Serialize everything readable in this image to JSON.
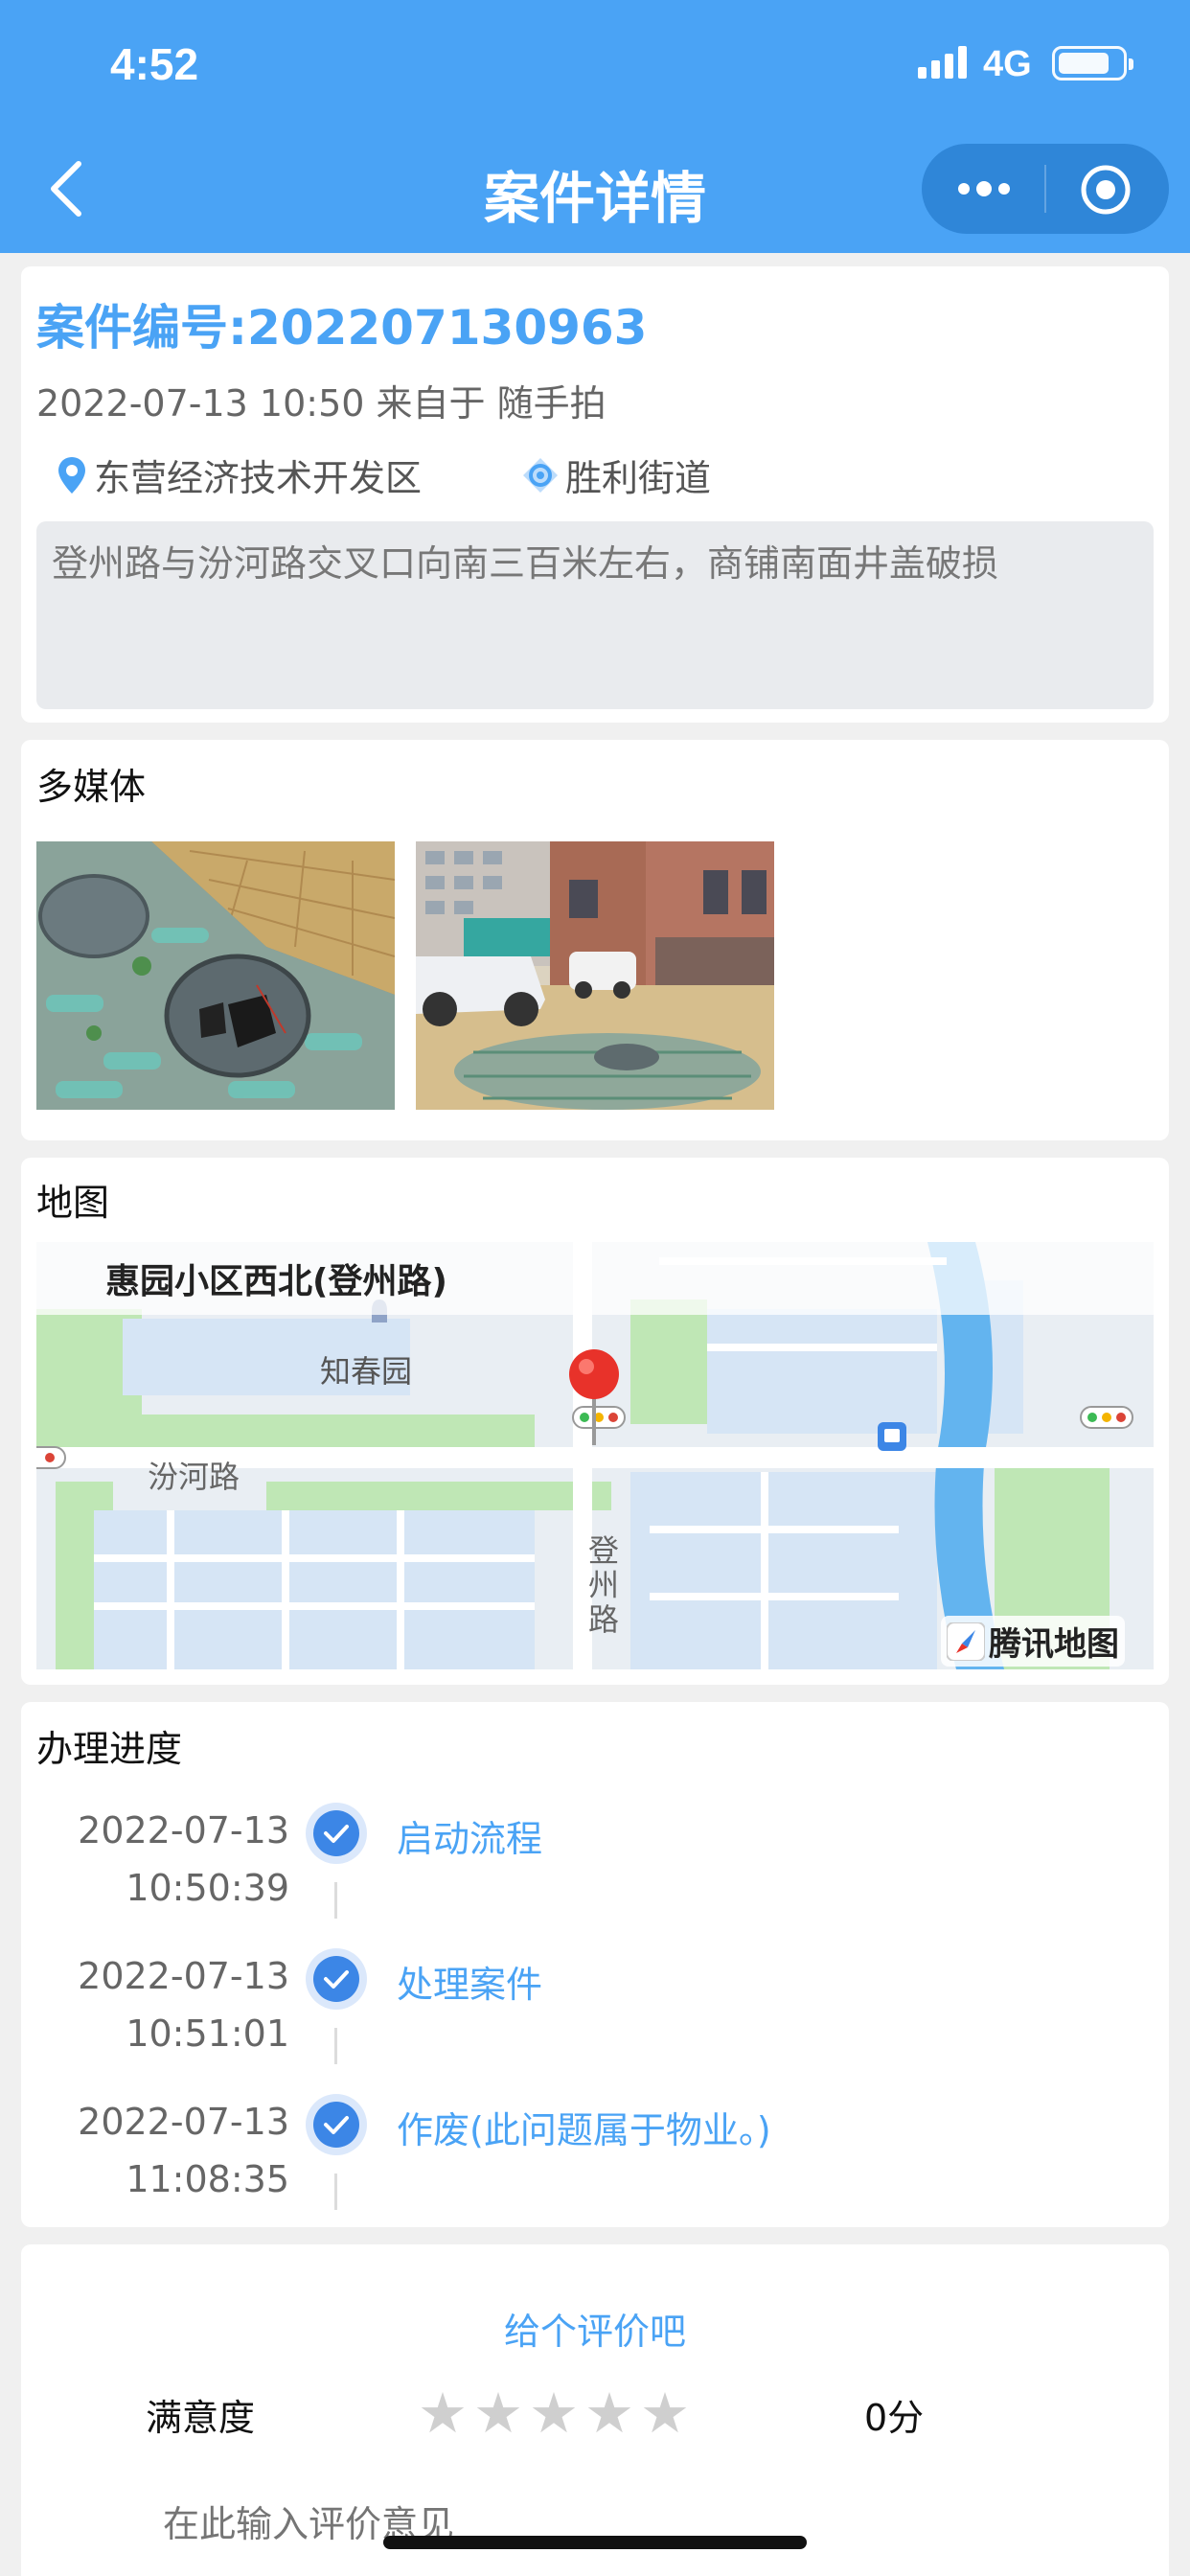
{
  "status_bar": {
    "time": "4:52",
    "network": "4G"
  },
  "nav": {
    "title": "案件详情"
  },
  "case": {
    "number": "案件编号:202207130963",
    "meta": "2022-07-13 10:50 来自于 随手拍",
    "district": "东营经济技术开发区",
    "street": "胜利街道",
    "description": "登州路与汾河路交叉口向南三百米左右，商铺南面井盖破损"
  },
  "media": {
    "title": "多媒体"
  },
  "map": {
    "title": "地图",
    "location_label": "惠园小区西北(登州路)",
    "poi": "知春园",
    "road_h": "汾河路",
    "road_v": "登州路",
    "provider": "腾讯地图"
  },
  "progress": {
    "title": "办理进度",
    "steps": [
      {
        "date": "2022-07-13",
        "time": "10:50:39",
        "label": "启动流程"
      },
      {
        "date": "2022-07-13",
        "time": "10:51:01",
        "label": "处理案件"
      },
      {
        "date": "2022-07-13",
        "time": "11:08:35",
        "label": "作废(此问题属于物业。)"
      }
    ]
  },
  "rating": {
    "title": "给个评价吧",
    "label": "满意度",
    "stars": [
      "★",
      "★",
      "★",
      "★",
      "★"
    ],
    "score": "0分",
    "placeholder": "在此输入评价意见"
  },
  "colors": {
    "brand": "#4aa3f5",
    "capsule": "#2f86d8",
    "check": "#3c86e6"
  }
}
